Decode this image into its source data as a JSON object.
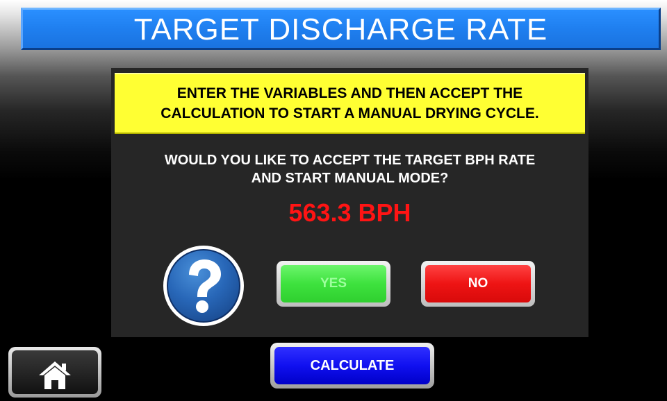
{
  "header": {
    "title": "TARGET DISCHARGE RATE"
  },
  "dialog": {
    "instruction_line1": "ENTER THE VARIABLES AND THEN ACCEPT THE",
    "instruction_line2": "CALCULATION TO START A MANUAL DRYING CYCLE.",
    "question_line1": "WOULD YOU LIKE TO ACCEPT THE TARGET BPH RATE",
    "question_line2": "AND START MANUAL MODE?",
    "rate_value": "563.3 BPH",
    "help_icon": "question-mark-icon",
    "yes_label": "YES",
    "no_label": "NO"
  },
  "footer": {
    "home_icon": "home-icon",
    "calculate_label": "CALCULATE"
  },
  "colors": {
    "title_bar": "#1f7fef",
    "instruction_bg": "#ffff33",
    "rate_text": "#ff1414",
    "yes_button": "#3ee23e",
    "no_button": "#ee1414",
    "calculate_button": "#1010f0"
  }
}
